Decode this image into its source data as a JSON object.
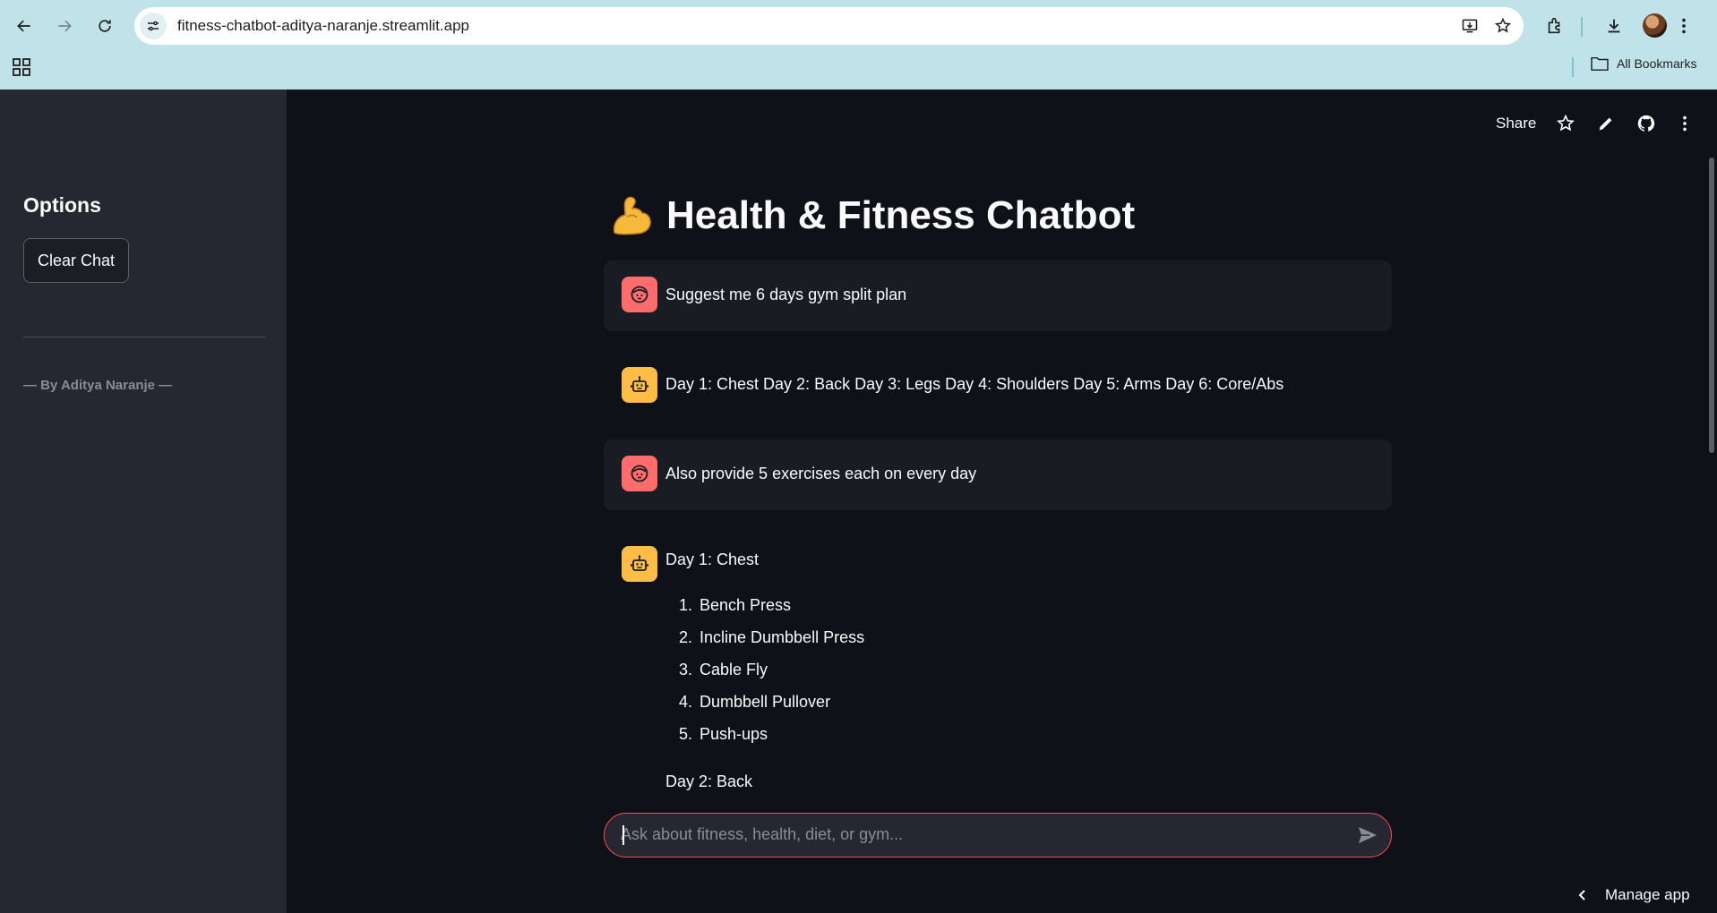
{
  "browser": {
    "url": "fitness-chatbot-aditya-naranje.streamlit.app",
    "bookmarks_label": "All Bookmarks",
    "icons": [
      "back-icon",
      "forward-icon",
      "reload-icon",
      "site-info-icon",
      "install-app-icon",
      "star-icon",
      "extensions-icon",
      "download-icon",
      "profile-avatar",
      "more-icon",
      "apps-icon",
      "folder-icon"
    ]
  },
  "sidebar": {
    "title": "Options",
    "clear_button": "Clear Chat",
    "credit": "— By Aditya Naranje —"
  },
  "header": {
    "share_label": "Share",
    "icons": [
      "star-icon",
      "edit-icon",
      "github-icon",
      "more-icon"
    ]
  },
  "main": {
    "title_emoji": "flexed-biceps-icon",
    "title": "Health & Fitness Chatbot"
  },
  "messages": [
    {
      "role": "user",
      "text": "Suggest me 6 days gym split plan"
    },
    {
      "role": "assistant",
      "text": "Day 1: Chest Day 2: Back Day 3: Legs Day 4: Shoulders Day 5: Arms Day 6: Core/Abs"
    },
    {
      "role": "user",
      "text": "Also provide 5 exercises each on every day"
    },
    {
      "role": "assistant",
      "heading": "Day 1: Chest",
      "list": [
        {
          "num": "1.",
          "text": "Bench Press"
        },
        {
          "num": "2.",
          "text": "Incline Dumbbell Press"
        },
        {
          "num": "3.",
          "text": "Cable Fly"
        },
        {
          "num": "4.",
          "text": "Dumbbell Pullover"
        },
        {
          "num": "5.",
          "text": "Push-ups"
        }
      ],
      "next_heading": "Day 2: Back"
    }
  ],
  "chat_input": {
    "placeholder": "Ask about fitness, health, diet, or gym..."
  },
  "footer": {
    "manage_app_label": "Manage app"
  },
  "colors": {
    "background": "#0e1117",
    "sidebar": "#262730",
    "user_avatar": "#ff6c6c",
    "assistant_avatar": "#ffbd45",
    "input_border": "#ff4b4b",
    "browser_chrome": "#bfe3e8"
  }
}
